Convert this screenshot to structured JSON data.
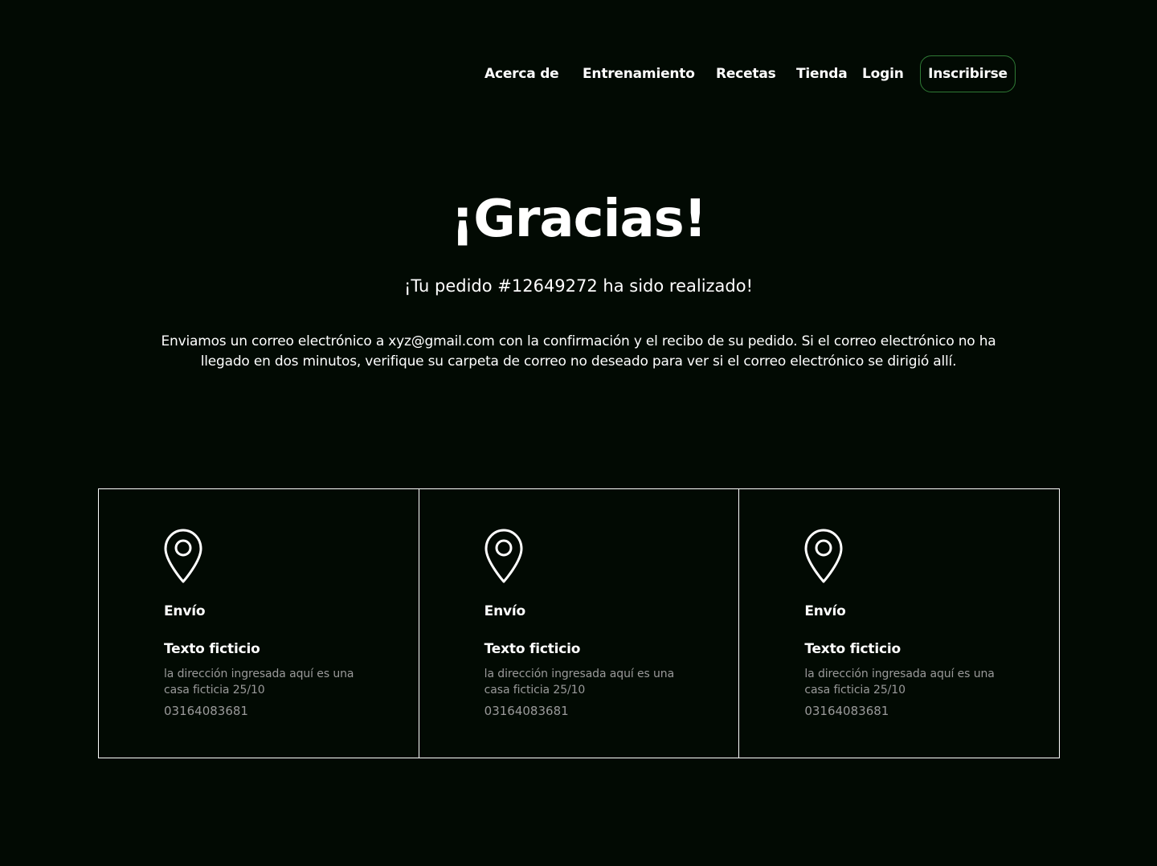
{
  "nav": {
    "items": [
      {
        "label": "Acerca de"
      },
      {
        "label": "Entrenamiento"
      },
      {
        "label": "Recetas"
      },
      {
        "label": "Tienda"
      },
      {
        "label": "Login"
      }
    ],
    "cta_label": "Inscribirse"
  },
  "hero": {
    "title": "¡Gracias!",
    "subtitle": "¡Tu pedido #12649272 ha sido realizado!",
    "body": "Enviamos un correo electrónico a xyz@gmail.com con la confirmación y el recibo de su pedido. Si el correo electrónico no ha llegado en dos minutos, verifique su carpeta de correo no deseado para ver si el correo electrónico se dirigió allí."
  },
  "cards": [
    {
      "icon": "location-pin-icon",
      "title": "Envío",
      "name": "Texto ficticio",
      "address": "la dirección ingresada aquí es una casa ficticia 25/10",
      "phone": "03164083681"
    },
    {
      "icon": "location-pin-icon",
      "title": "Envío",
      "name": "Texto ficticio",
      "address": "la dirección ingresada aquí es una casa ficticia 25/10",
      "phone": "03164083681"
    },
    {
      "icon": "location-pin-icon",
      "title": "Envío",
      "name": "Texto ficticio",
      "address": "la dirección ingresada aquí es una casa ficticia 25/10",
      "phone": "03164083681"
    }
  ],
  "colors": {
    "background": "#020a03",
    "accent_border": "#2f7a35",
    "text": "#ffffff",
    "muted_text": "#9a9a9a"
  }
}
